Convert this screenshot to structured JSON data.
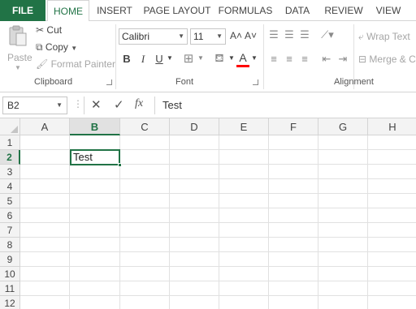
{
  "tabs": {
    "file": "FILE",
    "home": "HOME",
    "insert": "INSERT",
    "page_layout": "PAGE LAYOUT",
    "formulas": "FORMULAS",
    "data": "DATA",
    "review": "REVIEW",
    "view": "VIEW"
  },
  "clipboard": {
    "paste": "Paste",
    "cut": "Cut",
    "copy": "Copy",
    "format_painter": "Format Painter",
    "group_label": "Clipboard"
  },
  "font": {
    "family": "Calibri",
    "size": "11",
    "bold": "B",
    "italic": "I",
    "underline": "U",
    "font_color_letter": "A",
    "grow": "A˄",
    "shrink": "A˅",
    "group_label": "Font",
    "font_color": "#ff0000"
  },
  "alignment": {
    "wrap_text": "Wrap Text",
    "merge_center": "Merge & C",
    "group_label": "Alignment"
  },
  "formula_bar": {
    "name_box": "B2",
    "fx": "fx",
    "content": "Test"
  },
  "grid": {
    "columns": [
      "A",
      "B",
      "C",
      "D",
      "E",
      "F",
      "G",
      "H"
    ],
    "rows": [
      "1",
      "2",
      "3",
      "4",
      "5",
      "6",
      "7",
      "8",
      "9",
      "10",
      "11",
      "12"
    ],
    "active_column": "B",
    "active_row": "2",
    "cell_b2": "Test"
  },
  "colors": {
    "accent": "#217346"
  }
}
